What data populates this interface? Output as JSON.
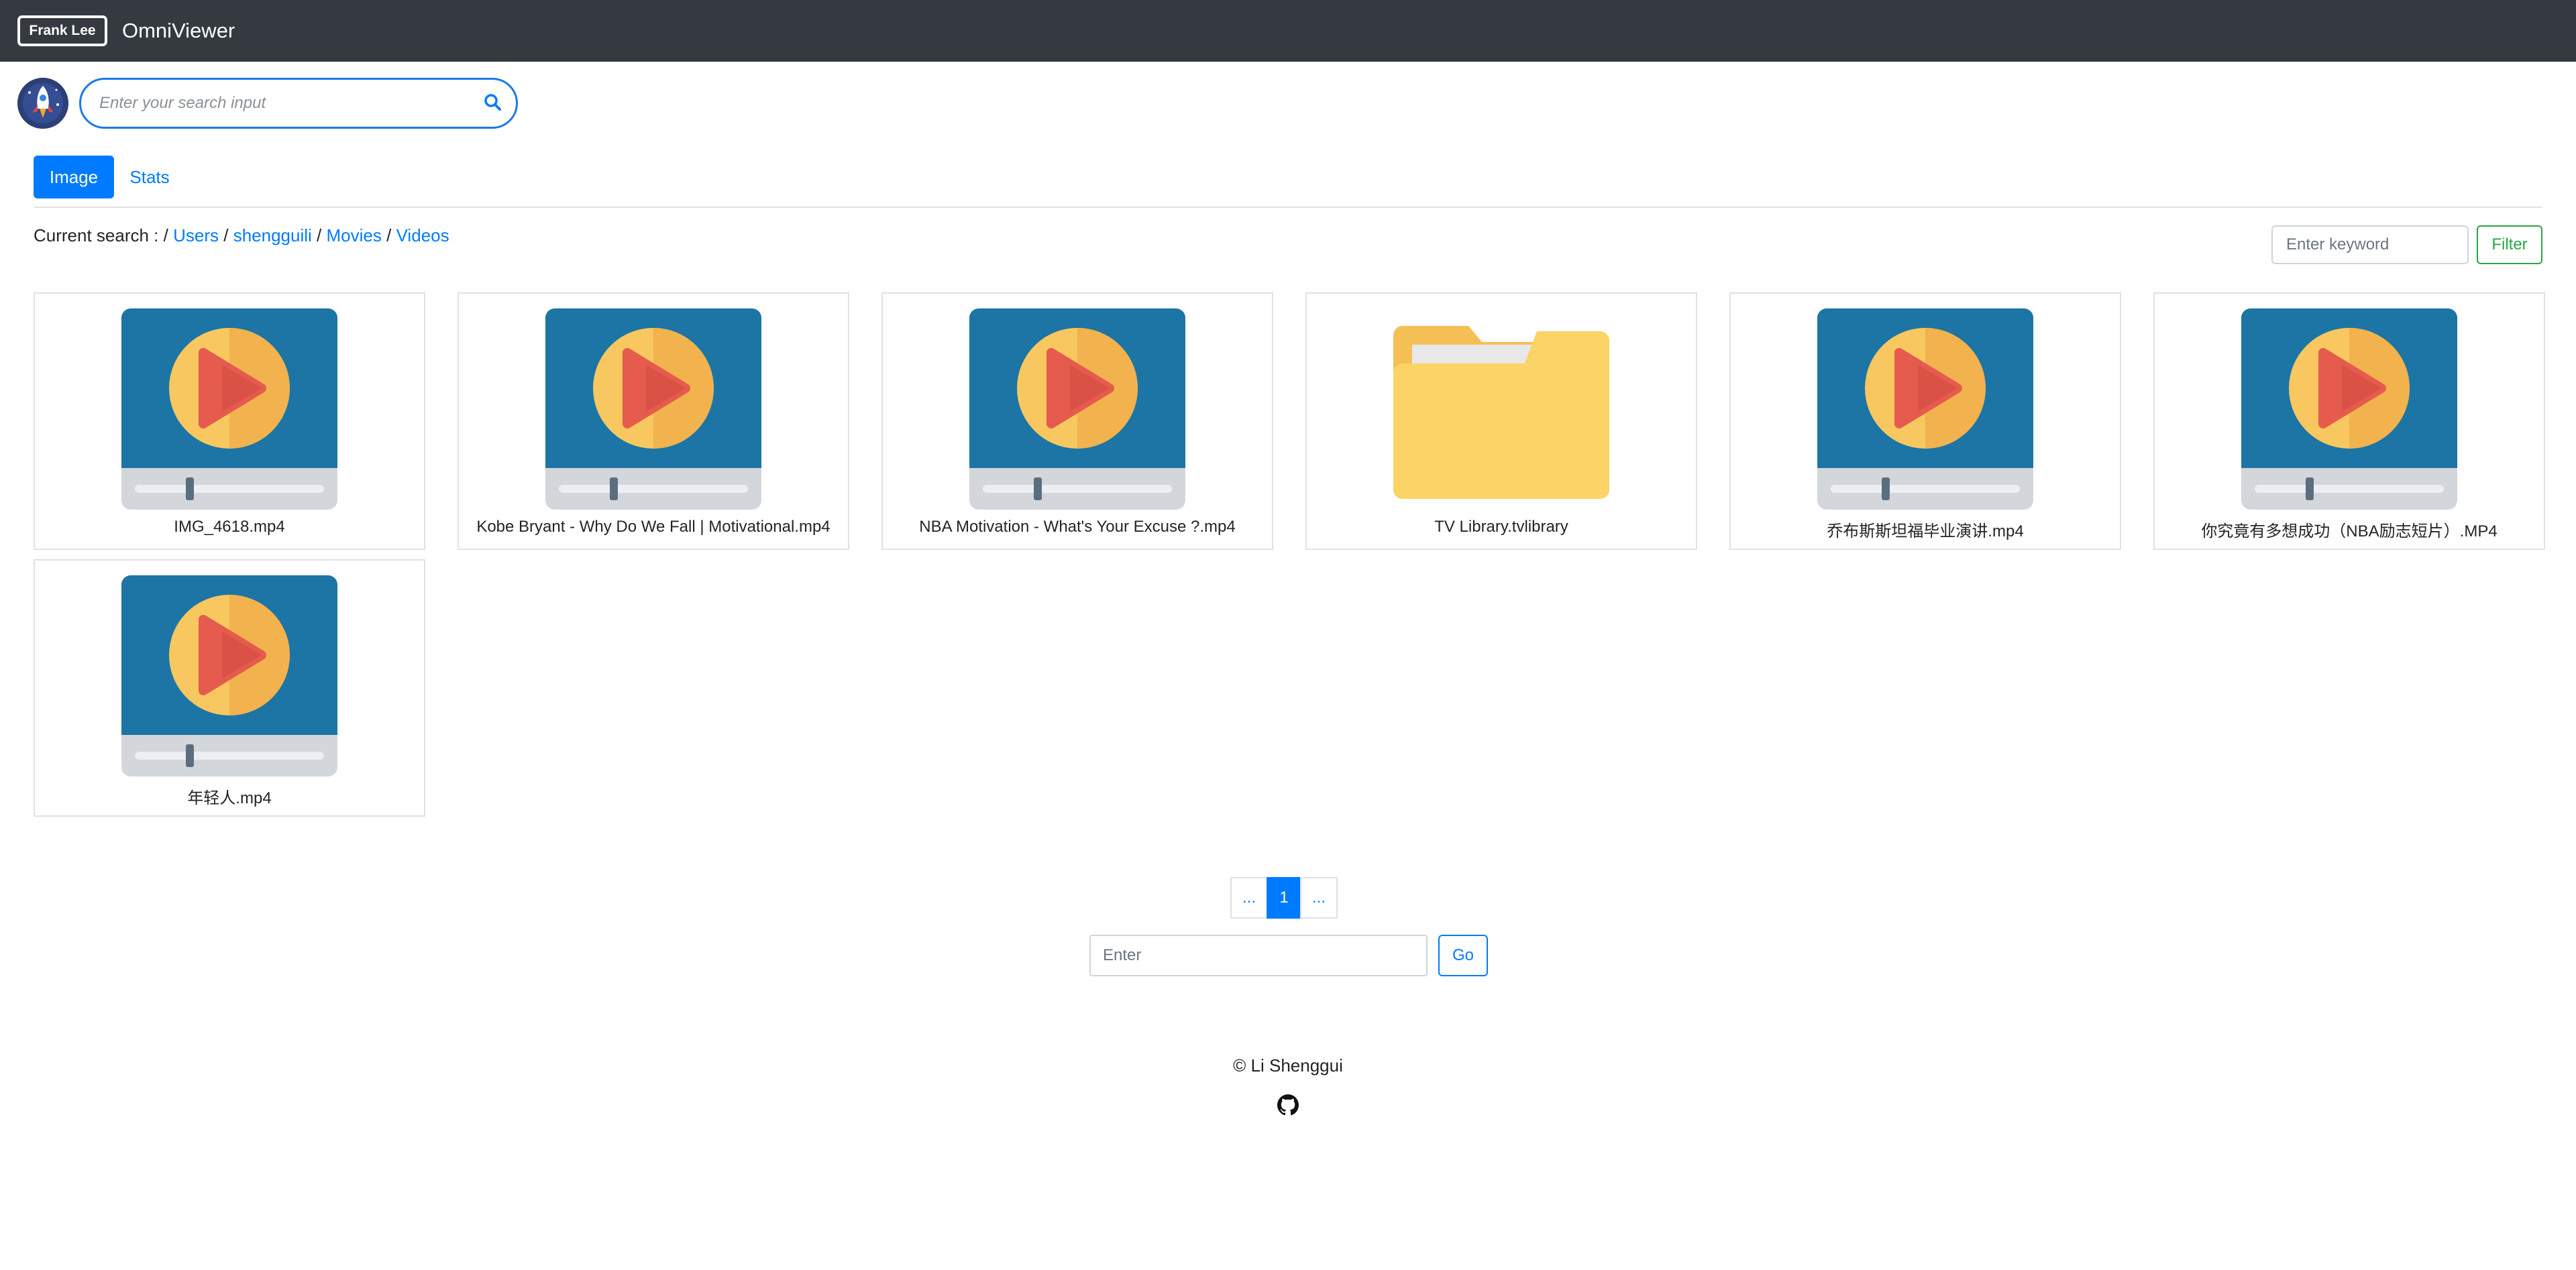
{
  "navbar": {
    "brand_badge": "Frank Lee",
    "app_title": "OmniViewer"
  },
  "search": {
    "placeholder": "Enter your search input"
  },
  "tabs": [
    {
      "label": "Image",
      "active": true
    },
    {
      "label": "Stats",
      "active": false
    }
  ],
  "breadcrumb": {
    "prefix": "Current search : /",
    "segments": [
      "Users",
      "shengguili",
      "Movies",
      "Videos"
    ],
    "separator": "/"
  },
  "filter": {
    "placeholder": "Enter keyword",
    "button_label": "Filter"
  },
  "files": [
    {
      "name": "IMG_4618.mp4",
      "icon": "video-icon"
    },
    {
      "name": "Kobe Bryant - Why Do We Fall | Motivational.mp4",
      "icon": "video-icon"
    },
    {
      "name": "NBA Motivation - What's Your Excuse ?.mp4",
      "icon": "video-icon"
    },
    {
      "name": "TV Library.tvlibrary",
      "icon": "folder-icon"
    },
    {
      "name": "乔布斯斯坦福毕业演讲.mp4",
      "icon": "video-icon"
    },
    {
      "name": "你究竟有多想成功（NBA励志短片）.MP4",
      "icon": "video-icon"
    },
    {
      "name": "年轻人.mp4",
      "icon": "video-icon"
    }
  ],
  "pagination": {
    "prev": "...",
    "current": "1",
    "next": "...",
    "goto_placeholder": "Enter",
    "go_label": "Go"
  },
  "footer": {
    "copyright": "© Li Shenggui",
    "github_icon": "github-icon"
  },
  "colors": {
    "navbar_bg": "#343a40",
    "primary": "#007bff",
    "success": "#28a745"
  }
}
